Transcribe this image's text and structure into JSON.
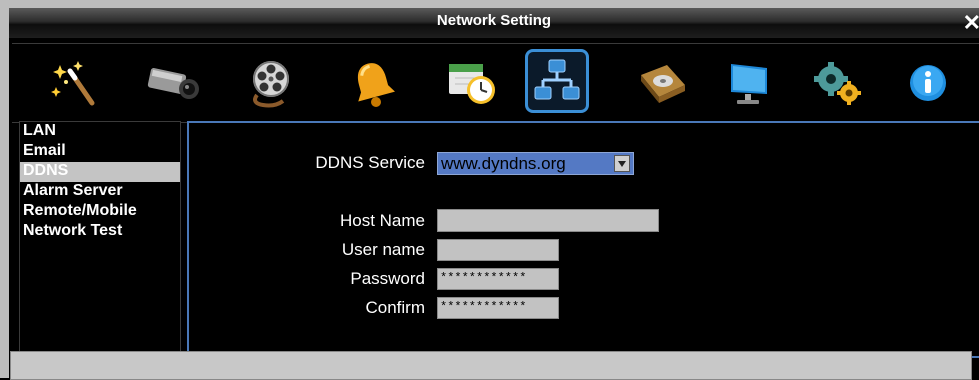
{
  "window": {
    "title": "Network Setting",
    "close_glyph": "✕"
  },
  "toolbar": {
    "icons": [
      "magic-wand-icon",
      "camera-icon",
      "film-reel-icon",
      "alarm-bell-icon",
      "schedule-clock-icon",
      "network-icon",
      "hard-disk-icon",
      "monitor-icon",
      "system-gears-icon",
      "info-icon"
    ],
    "selected": "network-icon"
  },
  "menu": {
    "items": [
      "LAN",
      "Email",
      "DDNS",
      "Alarm Server",
      "Remote/Mobile",
      "Network Test"
    ],
    "selected": "DDNS"
  },
  "form": {
    "ddns_service_label": "DDNS Service",
    "ddns_service_value": "www.dyndns.org",
    "host_name_label": "Host Name",
    "host_name_value": "",
    "user_name_label": "User name",
    "user_name_value": "",
    "password_label": "Password",
    "password_value": "************",
    "confirm_label": "Confirm",
    "confirm_value": "************"
  },
  "colors": {
    "accent": "#4a78b8",
    "selected_menu": "#c4c4c4",
    "select_bg": "#5479c4"
  }
}
